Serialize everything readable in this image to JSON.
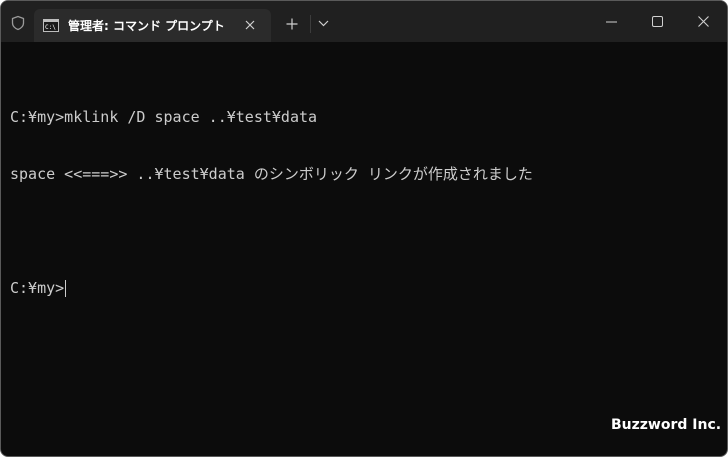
{
  "titlebar": {
    "tab_title": "管理者: コマンド プロンプト",
    "tab_icon": "terminal-icon",
    "shield_icon": "shield-icon",
    "close_tab_icon": "close-icon",
    "new_tab_icon": "plus-icon",
    "dropdown_icon": "chevron-down-icon",
    "minimize_icon": "minimize-icon",
    "maximize_icon": "maximize-icon",
    "close_window_icon": "close-icon"
  },
  "console": {
    "lines": [
      "C:¥my>mklink /D space ..¥test¥data",
      "space <<===>> ..¥test¥data のシンボリック リンクが作成されました",
      "",
      "C:¥my>"
    ]
  },
  "watermark": {
    "text": "Buzzword Inc."
  },
  "colors": {
    "titlebar_bg": "#202020",
    "tab_bg": "#2b2b2b",
    "console_bg": "#0c0c0c",
    "console_text": "#cccccc"
  }
}
